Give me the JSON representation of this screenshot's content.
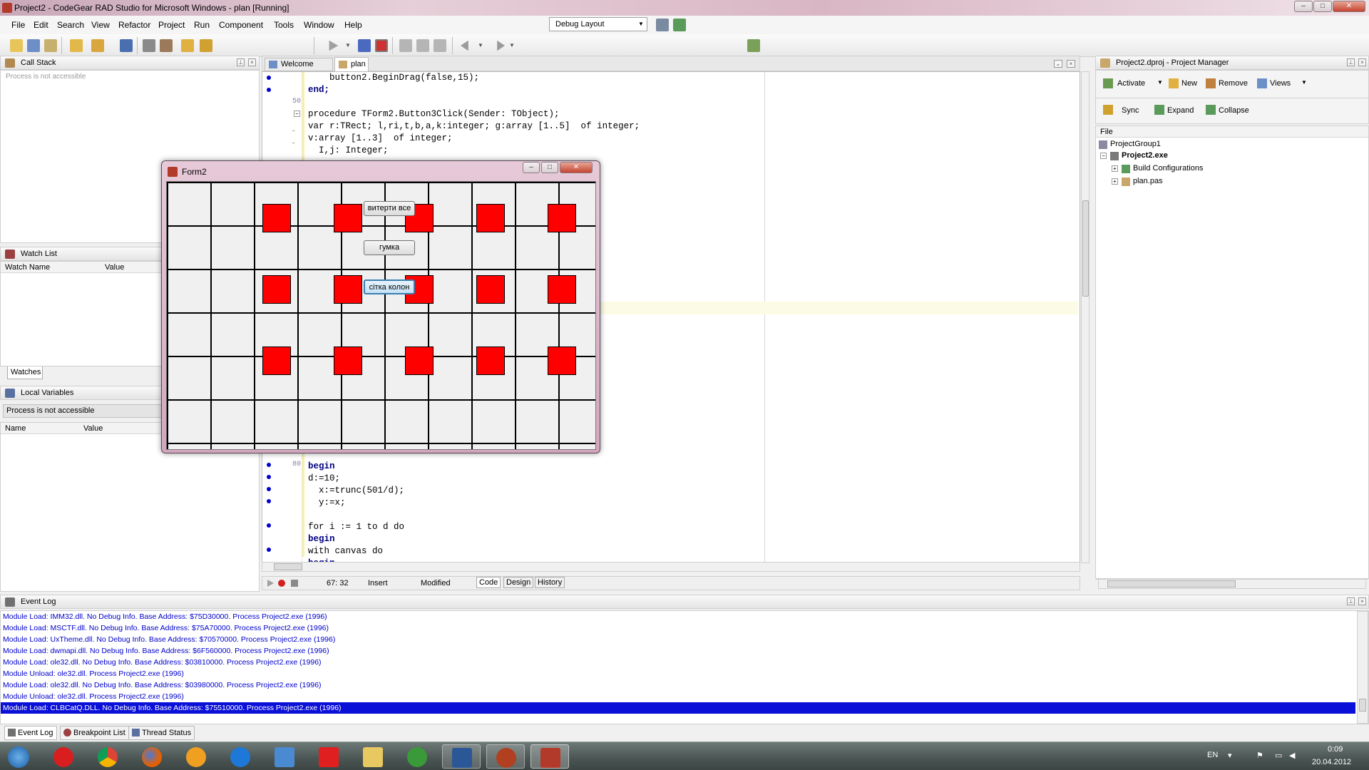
{
  "window": {
    "title": "Project2 - CodeGear RAD Studio for Microsoft Windows - plan [Running]"
  },
  "menu": [
    "File",
    "Edit",
    "Search",
    "View",
    "Refactor",
    "Project",
    "Run",
    "Component",
    "Tools",
    "Window",
    "Help"
  ],
  "layout_select": {
    "value": "Debug Layout"
  },
  "call_stack": {
    "title": "Call Stack",
    "status": "Process is not accessible"
  },
  "watch_list": {
    "title": "Watch List",
    "col_name": "Watch Name",
    "col_value": "Value",
    "tab": "Watches"
  },
  "local_vars": {
    "title": "Local Variables",
    "status": "Process is not accessible",
    "col_name": "Name",
    "col_value": "Value"
  },
  "editor": {
    "tabs": [
      "Welcome Page",
      "plan"
    ],
    "lines_top": [
      {
        "text": "    button2.BeginDrag(false,15);"
      },
      {
        "text": "end;"
      },
      {
        "text": ""
      },
      {
        "text": "procedure TForm2.Button3Click(Sender: TObject);"
      },
      {
        "text": "var r:TRect; l,ri,t,b,a,k:integer; g:array [1..5]  of integer;"
      },
      {
        "text": "v:array [1..3]  of integer;"
      },
      {
        "text": "  I,j: Integer;"
      }
    ],
    "lines_bottom": [
      {
        "text": "I,d,x,y:integer;"
      },
      {
        "text": "begin"
      },
      {
        "text": "d:=10;"
      },
      {
        "text": "  x:=trunc(501/d);"
      },
      {
        "text": "  y:=x;"
      },
      {
        "text": ""
      },
      {
        "text": "for i := 1 to d do"
      },
      {
        "text": "begin"
      },
      {
        "text": "with canvas do"
      },
      {
        "text": "begin"
      }
    ],
    "line_numbers": {
      "n50": "50",
      "n80": "80"
    },
    "status": {
      "position": "67: 32",
      "mode": "Insert",
      "modified": "Modified"
    },
    "view_tabs": [
      "Code",
      "Design",
      "History"
    ]
  },
  "form2": {
    "title": "Form2",
    "buttons": {
      "b1": "витерти все",
      "b2": "гумка",
      "b3": "сітка колон"
    }
  },
  "project_manager": {
    "title": "Project2.dproj - Project Manager",
    "toolbar": {
      "activate": "Activate",
      "new": "New",
      "remove": "Remove",
      "views": "Views",
      "sync": "Sync",
      "expand": "Expand",
      "collapse": "Collapse"
    },
    "header": "File",
    "tree": {
      "group": "ProjectGroup1",
      "exe": "Project2.exe",
      "build": "Build Configurations",
      "unit": "plan.pas"
    }
  },
  "event_log": {
    "title": "Event Log",
    "lines": [
      "Module Load: IMM32.dll. No Debug Info. Base Address: $75D30000. Process Project2.exe (1996)",
      "Module Load: MSCTF.dll. No Debug Info. Base Address: $75A70000. Process Project2.exe (1996)",
      "Module Load: UxTheme.dll. No Debug Info. Base Address: $70570000. Process Project2.exe (1996)",
      "Module Load: dwmapi.dll. No Debug Info. Base Address: $6F560000. Process Project2.exe (1996)",
      "Module Load: ole32.dll. No Debug Info. Base Address: $03810000. Process Project2.exe (1996)",
      "Module Unload: ole32.dll. Process Project2.exe (1996)",
      "Module Load: ole32.dll. No Debug Info. Base Address: $03980000. Process Project2.exe (1996)",
      "Module Unload: ole32.dll. Process Project2.exe (1996)",
      "Module Load: CLBCatQ.DLL. No Debug Info. Base Address: $75510000. Process Project2.exe (1996)"
    ],
    "selected_index": 8
  },
  "bottom_tabs": [
    "Event Log",
    "Breakpoint List",
    "Thread Status"
  ],
  "taskbar": {
    "lang": "EN",
    "time": "0:09",
    "date": "20.04.2012"
  }
}
